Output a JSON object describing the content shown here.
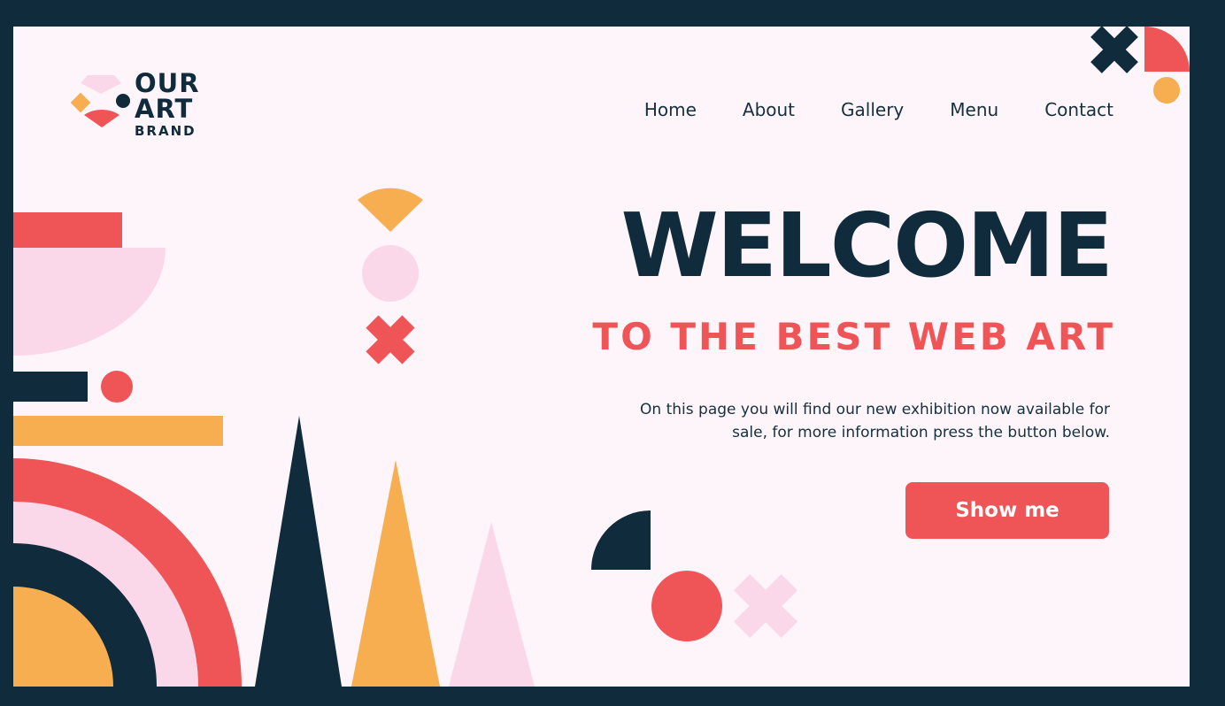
{
  "brand": {
    "line1": "OUR",
    "line2": "ART",
    "line3": "BRAND"
  },
  "nav": {
    "items": [
      {
        "label": "Home"
      },
      {
        "label": "About"
      },
      {
        "label": "Gallery"
      },
      {
        "label": "Menu"
      },
      {
        "label": "Contact"
      }
    ]
  },
  "hero": {
    "title": "WELCOME",
    "subtitle": "TO THE BEST WEB ART",
    "description": "On this page you will find our new exhibition now available for sale, for more information press the button below.",
    "button_label": "Show me"
  },
  "colors": {
    "navy": "#0f2b3c",
    "coral": "#ef5457",
    "pink": "#fad8ea",
    "orange": "#f6ae51",
    "background": "#fdf5f9"
  }
}
